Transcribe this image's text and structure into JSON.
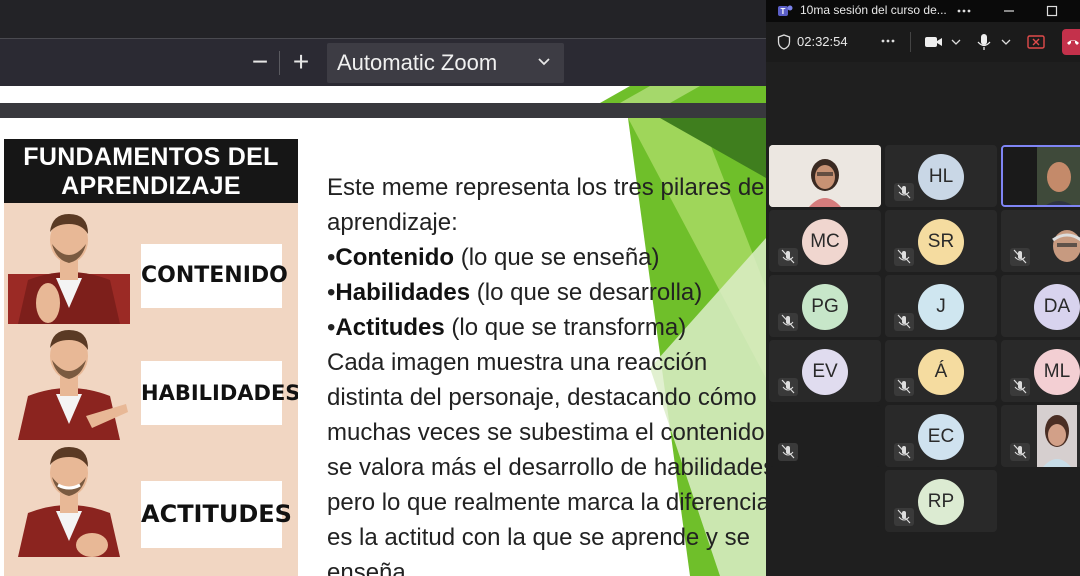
{
  "pdf_viewer": {
    "zoom_out_glyph": "−",
    "zoom_in_glyph": "+",
    "zoom_label": "Automatic Zoom",
    "icons": {
      "zoom_out": "minus-icon",
      "zoom_in": "plus-icon",
      "zoom_dropdown": "chevron-down-icon"
    }
  },
  "slide": {
    "meme_title": "FUNDAMENTOS DEL APRENDIZAJE",
    "meme_labels": [
      "CONTENIDO",
      "HABILIDADES",
      "ACTITUDES"
    ],
    "text": {
      "intro": "Este meme representa los tres pilares del aprendizaje:",
      "bullets": [
        {
          "marker": "•",
          "term": "Contenido",
          "desc": " (lo que se enseña)"
        },
        {
          "marker": "•",
          "term": "Habilidades",
          "desc": " (lo que se desarrolla)"
        },
        {
          "marker": "•",
          "term": "Actitudes",
          "desc": " (lo que se transforma)"
        }
      ],
      "paragraph": "Cada imagen muestra una reacción distinta del personaje, destacando cómo muchas veces se subestima el contenido, se valora más el desarrollo de habilidades, pero lo que realmente marca la diferencia es la actitud con la que se aprende y se enseña."
    },
    "accent_green": "#6fbf2a",
    "accent_dark_green": "#3f7e1e"
  },
  "teams": {
    "window_title": "10ma sesión del curso de...",
    "timer": "02:32:54",
    "icons": {
      "app": "teams-icon",
      "more": "more-icon",
      "minimize": "minimize-icon",
      "maximize": "maximize-icon",
      "shield": "shield-icon",
      "camera": "camera-icon",
      "mic": "mic-icon",
      "share": "share-icon",
      "leave": "leave-call-icon"
    },
    "participants": [
      {
        "initials": "",
        "color": "#e9e4de"
      },
      {
        "initials": "HL",
        "color": "#c9d7e6"
      },
      {
        "initials": "",
        "color": "#3a3a3a"
      },
      {
        "initials": "MC",
        "color": "#f0d6cf"
      },
      {
        "initials": "SR",
        "color": "#f5dca0"
      },
      {
        "initials": "",
        "color": "#3a3a3a"
      },
      {
        "initials": "PG",
        "color": "#c7e6c9"
      },
      {
        "initials": "J",
        "color": "#cfe6f0"
      },
      {
        "initials": "DA",
        "color": "#d8d3ee"
      },
      {
        "initials": "EV",
        "color": "#e0dcef"
      },
      {
        "initials": "Á",
        "color": "#f5dca0"
      },
      {
        "initials": "ML",
        "color": "#f3cfd3"
      },
      {
        "initials": "",
        "color": "#292929"
      },
      {
        "initials": "EC",
        "color": "#cfe2ef"
      },
      {
        "initials": "",
        "color": "#3a3a3a"
      },
      {
        "initials": "RP",
        "color": "#dcebd2"
      }
    ]
  }
}
